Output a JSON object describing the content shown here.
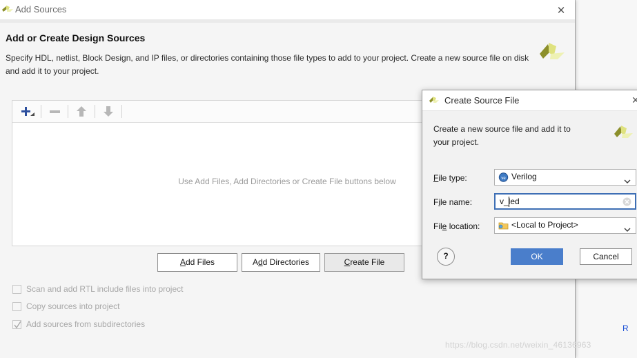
{
  "add_sources": {
    "title": "Add Sources",
    "title_icon": "vivado-logo-icon",
    "close_icon": "close-icon",
    "heading": "Add or Create Design Sources",
    "description": "Specify HDL, netlist, Block Design, and IP files, or directories containing those file types to add to your project. Create a new source file on disk and add it to your project.",
    "logo_icon": "vivado-logo-icon",
    "toolbar": {
      "add_label": "+",
      "add_icon": "plus-with-dropdown-icon",
      "remove_icon": "minus-icon",
      "move_up_icon": "arrow-up-icon",
      "move_down_icon": "arrow-down-icon"
    },
    "empty_text": "Use Add Files, Add Directories or Create File buttons below",
    "buttons": {
      "add_files": "Add Files",
      "add_directories": "Add Directories",
      "create_file": "Create File"
    },
    "checkboxes": [
      {
        "label": "Scan and add RTL include files into project",
        "checked": false,
        "enabled": false
      },
      {
        "label": "Copy sources into project",
        "checked": false,
        "enabled": false
      },
      {
        "label": "Add sources from subdirectories",
        "checked": true,
        "enabled": false
      }
    ]
  },
  "create_source_file": {
    "title": "Create Source File",
    "title_icon": "vivado-logo-icon",
    "close_icon": "close-icon",
    "description": "Create a new source file and add it to your project.",
    "logo_icon": "vivado-logo-icon",
    "fields": {
      "file_type_label": "File type:",
      "file_type_value": "Verilog",
      "file_type_icon": "verilog-icon",
      "file_name_label": "File name:",
      "file_name_value": "v_led",
      "file_name_placeholder": "",
      "file_location_label": "File location:",
      "file_location_value": "<Local to Project>",
      "file_location_icon": "folder-icon"
    },
    "help_label": "?",
    "ok_label": "OK",
    "cancel_label": "Cancel"
  },
  "background": {
    "run_text": "R"
  },
  "watermark": "https://blog.csdn.net/weixin_46136963",
  "colors": {
    "accent_blue": "#4a7ecb",
    "focus_blue": "#3e6fb5",
    "logo_olive": "#a3a636",
    "logo_yellow": "#e6e98a",
    "plus_blue": "#2d4f9e",
    "link_blue": "#1a4fd6"
  }
}
